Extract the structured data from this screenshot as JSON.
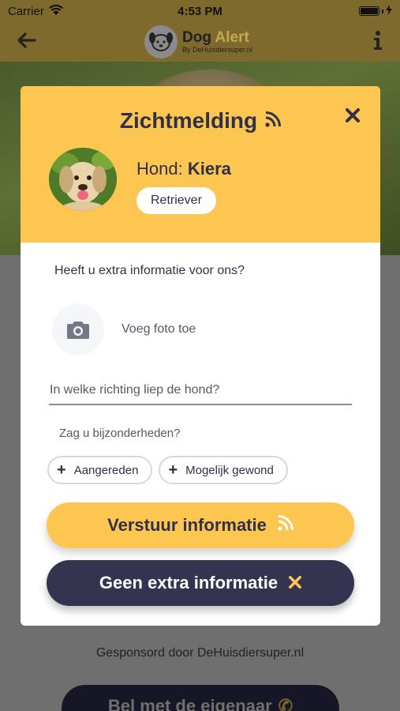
{
  "status_bar": {
    "carrier": "Carrier",
    "time": "4:53 PM",
    "icons": [
      "wifi-icon",
      "battery-icon",
      "charging-icon"
    ]
  },
  "header": {
    "back_icon": "arrow-left-icon",
    "logo": {
      "title_part1": "Dog",
      "title_part2": "Alert",
      "subtitle": "By DeHuisdiersuper.nl"
    },
    "info_icon": "info-icon"
  },
  "modal": {
    "title": "Zichtmelding",
    "title_icon": "rss-icon",
    "close_icon": "close-icon",
    "dog": {
      "label": "Hond:",
      "name": "Kiera",
      "breed": "Retriever"
    },
    "question": "Heeft u extra informatie voor ons?",
    "photo": {
      "icon": "camera-icon",
      "label": "Voeg foto toe"
    },
    "direction_input": {
      "placeholder": "In welke richting liep de hond?",
      "value": ""
    },
    "details_label": "Zag u bijzonderheden?",
    "chips": [
      {
        "label": "Aangereden",
        "icon": "plus-icon"
      },
      {
        "label": "Mogelijk gewond",
        "icon": "plus-icon"
      }
    ],
    "send_button": {
      "label": "Verstuur informatie",
      "icon": "rss-icon"
    },
    "none_button": {
      "label": "Geen extra informatie",
      "icon": "close-icon"
    }
  },
  "background": {
    "sponsor_text": "Gesponsord door DeHuisdiersuper.nl",
    "call_button": "Bel met de eigenaar",
    "call_icon": "phone-icon"
  },
  "colors": {
    "accent_yellow": "#fdc651",
    "dark_navy": "#353450",
    "text_dark": "#303048"
  }
}
